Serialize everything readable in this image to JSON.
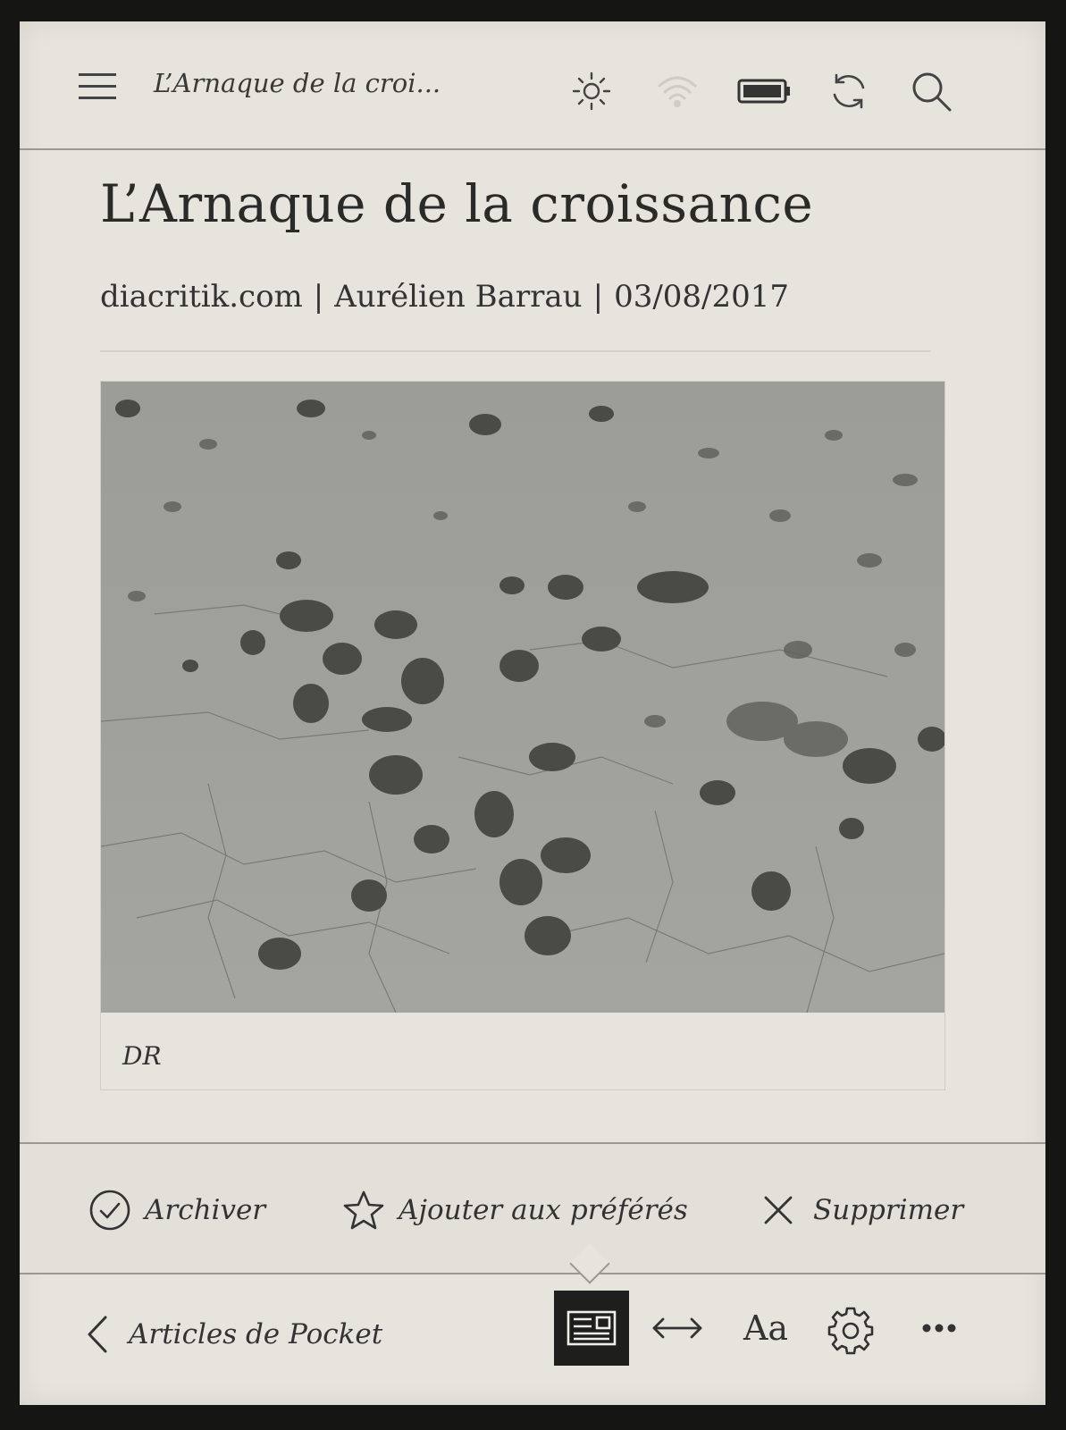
{
  "topbar": {
    "title": "L’Arnaque de la croi...",
    "icons": [
      "menu-icon",
      "brightness-icon",
      "wifi-icon",
      "battery-icon",
      "sync-icon",
      "search-icon"
    ]
  },
  "article": {
    "title": "L’Arnaque de la croissance",
    "source": "diacritik.com",
    "author": "Aurélien Barrau",
    "date": "03/08/2017",
    "separator": "|",
    "image_caption": "DR"
  },
  "actions": {
    "archive_label": "Archiver",
    "favorite_label": "Ajouter aux préférés",
    "delete_label": "Supprimer"
  },
  "bottombar": {
    "back_label": "Articles de Pocket",
    "font_label": "Aa",
    "icons": [
      "article-view-icon",
      "width-toggle-icon",
      "font-settings-icon",
      "gear-icon",
      "more-icon"
    ],
    "active": "article-view-icon"
  },
  "colors": {
    "screen_bg": "#e7e4de",
    "text": "#2a2a28",
    "active_bg": "#1e1e1c"
  }
}
